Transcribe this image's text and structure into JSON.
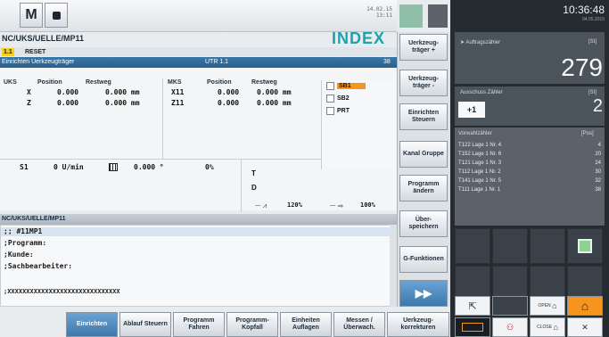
{
  "topbar": {
    "logo": "M",
    "time_line1": "14.02.15",
    "time_line2": "13:11"
  },
  "path": "NC/UKS/UELLE/MP11",
  "brand": "INDEX",
  "reset": {
    "chip": "1.1",
    "text": "RESET"
  },
  "title": {
    "left": "Einrichten Uerkzeugträger",
    "mid": "UTR 1.1",
    "right": "38"
  },
  "pos_headers": [
    "UKS",
    "Position",
    "Restweg",
    "MKS",
    "Position",
    "Restweg"
  ],
  "pos_rows": [
    {
      "axis": "X",
      "pos": "0.000",
      "rest": "0.000 mm",
      "maxis": "X11",
      "mpos": "0.000",
      "mrest": "0.000 mm"
    },
    {
      "axis": "Z",
      "pos": "0.000",
      "rest": "0.000 mm",
      "maxis": "Z11",
      "mpos": "0.000",
      "mrest": "0.000 mm"
    }
  ],
  "mf": [
    {
      "label": "SB1",
      "active": true
    },
    {
      "label": "SB2",
      "active": false
    },
    {
      "label": "PRT",
      "active": false
    }
  ],
  "spindle": {
    "name": "S1",
    "speed": "0 U/min",
    "angle": "0.000 °",
    "percent": "0%"
  },
  "tool": {
    "t": "T",
    "d": "D"
  },
  "override": {
    "feed": "120%",
    "rapid": "100%"
  },
  "program": {
    "title": "NC/UKS/UELLE/MP11",
    "lines": [
      ";; #11MP1",
      ";Programm:",
      ";Kunde:",
      ";Sachbearbeiter:",
      "",
      ";XXXXXXXXXXXXXXXXXXXXXXXXXXXXXX"
    ]
  },
  "vsoftkeys": [
    "Uerkzeug-träger +",
    "Uerkzeug-träger -",
    "Einrichten Steuern",
    "Kanal Gruppe",
    "Programm ändern",
    "Über-speichern",
    "G-Funktionen"
  ],
  "hsoftkeys": [
    "Einrichten",
    "Ablauf Steuern",
    "Programm Fahren",
    "Programm-Kopfall",
    "Einheiten Auflagen",
    "Messen / Überwach.",
    "Uerkzeug-korrekturen"
  ],
  "clock": {
    "time": "10:36:48",
    "date": "04.05.2015"
  },
  "counters": {
    "auftrag_label": "Auftragszähler",
    "auftrag_unit": "[St]",
    "auftrag_value": "279",
    "ausschuss_label": "Ausschuss Zähler",
    "ausschuss_unit": "[St]",
    "ausschuss_step": "+1",
    "ausschuss_value": "2"
  },
  "vorwahl": {
    "label": "Vorwahlzähler",
    "unit": "[Pos]",
    "items": [
      {
        "name": "T122 Lage 1 Nr. 4",
        "value": "4"
      },
      {
        "name": "T152 Lage 1 Nr. 6",
        "value": "20"
      },
      {
        "name": "T121 Lage 1 Nr. 3",
        "value": "24"
      },
      {
        "name": "T112 Lage 1 Nr. 2",
        "value": "30"
      },
      {
        "name": "T141 Lage 1 Nr. 5",
        "value": "32"
      },
      {
        "name": "T111 Lage 1 Nr. 1",
        "value": "38"
      }
    ]
  },
  "bottom_tiles": {
    "open": "OPEN",
    "close": "CLOSE"
  },
  "colors": {
    "accent": "#19a5ad",
    "active_mf": "#f7941d",
    "title_blue": "#2a5f8c",
    "home": "#f7941d"
  }
}
